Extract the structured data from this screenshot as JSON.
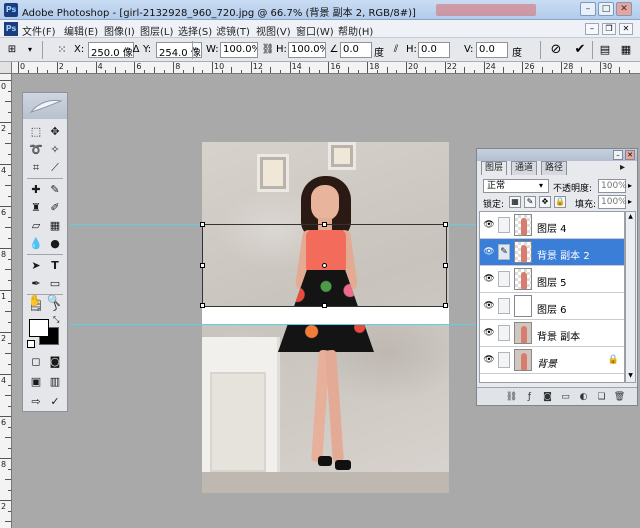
{
  "window": {
    "title": "Adobe Photoshop - [girl-2132928_960_720.jpg @ 66.7% (背景 副本 2, RGB/8#)]",
    "icon": "ps-icon",
    "minimize": "–",
    "maximize": "□",
    "close": "✕"
  },
  "menu": {
    "items": [
      "文件(F)",
      "编辑(E)",
      "图像(I)",
      "图层(L)",
      "选择(S)",
      "滤镜(T)",
      "视图(V)",
      "窗口(W)",
      "帮助(H)"
    ]
  },
  "options": {
    "x_label": "X:",
    "x_value": "250.0 像",
    "y_label": "Y:",
    "y_value": "254.0 像",
    "w_label": "W:",
    "w_value": "100.0%",
    "h_label": "H:",
    "h_value": "100.0%",
    "angle_value": "0.0",
    "angle_unit": "度",
    "skew_h_label": "H:",
    "skew_h_value": "0.0",
    "skew_v_label": "V:",
    "skew_v_value": "0.0",
    "skew_unit": "度"
  },
  "rulers": {
    "h_labels": [
      "0",
      "2",
      "4",
      "6",
      "8",
      "10",
      "12",
      "14",
      "16",
      "18",
      "20",
      "22",
      "24",
      "26",
      "28",
      "30"
    ],
    "v_labels": [
      "0",
      "2",
      "4",
      "6",
      "8",
      "1",
      "2",
      "4",
      "6",
      "8",
      "2"
    ]
  },
  "layers_panel": {
    "tabs": [
      "图层",
      "通道",
      "路径"
    ],
    "blend_mode": "正常",
    "opacity_label": "不透明度:",
    "opacity_value": "100%",
    "lock_label": "锁定:",
    "fill_label": "填充:",
    "fill_value": "100%",
    "layers": [
      {
        "name": "图层 4",
        "selected": false,
        "thumb": "transparent-figure"
      },
      {
        "name": "背景 副本 2",
        "selected": true,
        "thumb": "transparent-figure"
      },
      {
        "name": "图层 5",
        "selected": false,
        "thumb": "transparent-figure"
      },
      {
        "name": "图层 6",
        "selected": false,
        "thumb": "white"
      },
      {
        "name": "背景 副本",
        "selected": false,
        "thumb": "photo"
      },
      {
        "name": "背景",
        "selected": false,
        "thumb": "photo",
        "locked": true
      }
    ]
  },
  "colors": {
    "selection_blue": "#3b7ed8",
    "guide_cyan": "#5fd0e0",
    "dress_top": "#f26b5b"
  }
}
